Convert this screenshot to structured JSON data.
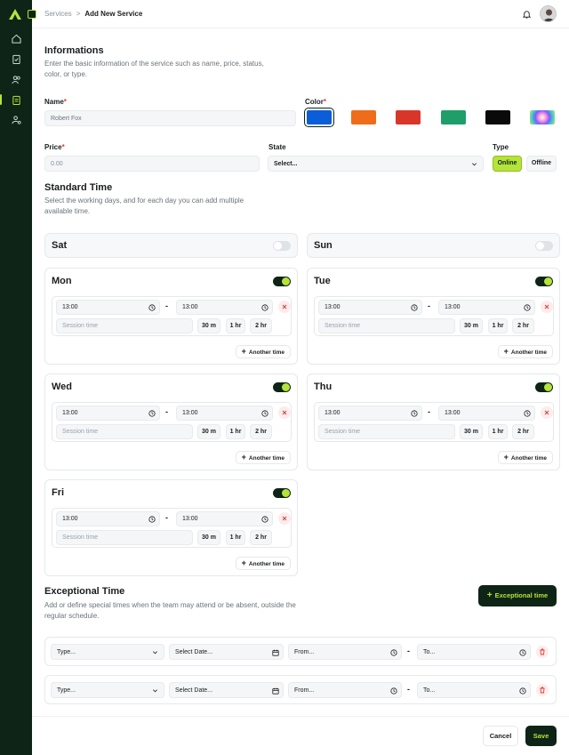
{
  "breadcrumb": {
    "parent": "Services",
    "separator": ">",
    "current": "Add New Service"
  },
  "informations": {
    "title": "Informations",
    "description": "Enter the basic information of the service such as name, price, status, color, or type.",
    "name_label": "Name",
    "name_value": "Robert Fox",
    "color_label": "Color",
    "colors": [
      "#0b5ed7",
      "#ef6c1a",
      "#d9362a",
      "#1f9e6a",
      "#0a0a0a",
      "rainbow"
    ],
    "price_label": "Price",
    "price_placeholder": "0.00",
    "state_label": "State",
    "state_value": "Select...",
    "type_label": "Type",
    "type_online": "Online",
    "type_offline": "Offline"
  },
  "standard": {
    "title": "Standard Time",
    "description": "Select the working days, and for each day you can add multiple available time.",
    "days": {
      "sat": "Sat",
      "sun": "Sun",
      "mon": "Mon",
      "tue": "Tue",
      "wed": "Wed",
      "thu": "Thu",
      "fri": "Fri"
    },
    "start": "13:00",
    "end": "13:00",
    "session_placeholder": "Session time",
    "chip_30": "30 m",
    "chip_1": "1 hr",
    "chip_2": "2 hr",
    "another": "Another time"
  },
  "exceptional": {
    "title": "Exceptional Time",
    "description": "Add or define special times when the team may attend or be absent, outside the regular schedule.",
    "button": "Exceptional time",
    "type_placeholder": "Type...",
    "date_placeholder": "Select Date...",
    "from_placeholder": "From...",
    "to_placeholder": "To..."
  },
  "footer": {
    "cancel": "Cancel",
    "save": "Save"
  }
}
